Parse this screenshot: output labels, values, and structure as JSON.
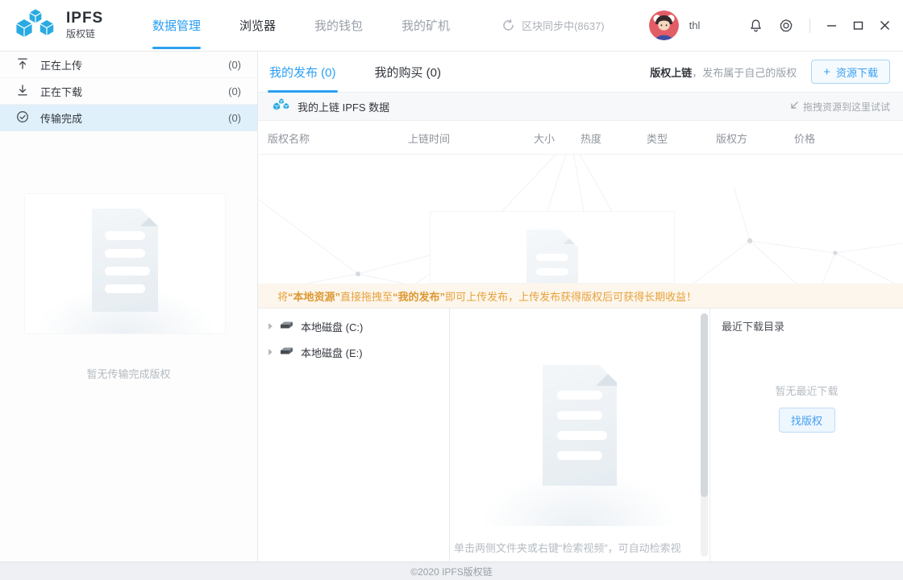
{
  "colors": {
    "accent": "#2b9ff3",
    "logo_blue": "#29abe2",
    "notice_fg": "#e6a23c",
    "notice_bg": "#fdf6ec",
    "active_row_bg": "#dff0fb",
    "avatar_bg": "#e25d66"
  },
  "header": {
    "brand": {
      "title": "IPFS",
      "subtitle": "版权链"
    },
    "nav": [
      {
        "label": "数据管理"
      },
      {
        "label": "浏览器"
      },
      {
        "label": "我的钱包"
      },
      {
        "label": "我的矿机"
      }
    ],
    "sync_status": "区块同步中(8637)",
    "username": "thl"
  },
  "sidebar": {
    "items": [
      {
        "label": "正在上传",
        "count": "(0)"
      },
      {
        "label": "正在下载",
        "count": "(0)"
      },
      {
        "label": "传输完成",
        "count": "(0)"
      }
    ],
    "empty_text": "暂无传输完成版权"
  },
  "main": {
    "tabs": [
      {
        "label": "我的发布 (0)"
      },
      {
        "label": "我的购买 (0)"
      }
    ],
    "publish_hint_bold": "版权上链",
    "publish_hint_rest": "，发布属于自己的版权",
    "download_button": {
      "plus": "+",
      "label": "资源下载"
    },
    "subheader": {
      "title": "我的上链 IPFS 数据",
      "drag_hint": "拖拽资源到这里试试"
    },
    "table_headers": [
      "版权名称",
      "上链时间",
      "大小",
      "热度",
      "类型",
      "版权方",
      "价格"
    ],
    "notice": {
      "p1": "将 ",
      "b1": "“本地资源”",
      "p2": " 直接拖拽至 ",
      "b2": "“我的发布”",
      "p3": " 即可上传发布，上传发布获得版权后可获得长期收益！"
    }
  },
  "explorer": {
    "tree": [
      {
        "label": "本地磁盘 (C:)"
      },
      {
        "label": "本地磁盘 (E:)"
      }
    ],
    "hint": "单击两侧文件夹或右键“检索视频”，可自动检索视",
    "recent": {
      "title": "最近下载目录",
      "empty_text": "暂无最近下载",
      "find_button": "找版权"
    }
  },
  "footer": {
    "copyright": "©2020 IPFS版权链"
  }
}
